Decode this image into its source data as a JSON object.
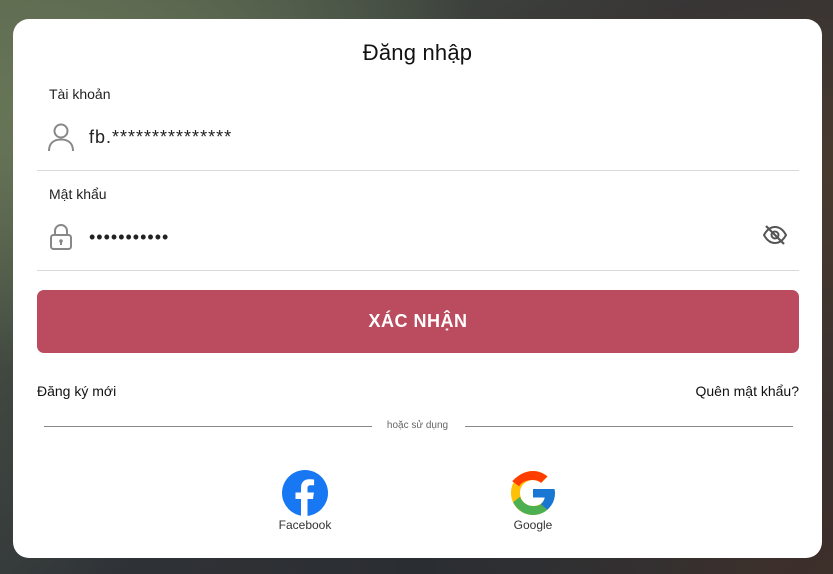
{
  "login": {
    "title": "Đăng nhập",
    "account": {
      "label": "Tài khoản",
      "value": "fb.***************",
      "icon": "user-icon"
    },
    "password": {
      "label": "Mật khẩu",
      "value": "•••••••••••",
      "icon": "lock-icon",
      "toggle_icon": "eye-off-icon"
    },
    "submit_label": "XÁC NHẬN",
    "register_link": "Đăng ký mới",
    "forgot_link": "Quên mật khẩu?",
    "divider_text": "hoặc sử dụng",
    "social": [
      {
        "label": "Facebook",
        "icon": "facebook-icon"
      },
      {
        "label": "Google",
        "icon": "google-icon"
      }
    ]
  },
  "colors": {
    "accent": "#bb4b5e",
    "facebook": "#1877f2"
  }
}
